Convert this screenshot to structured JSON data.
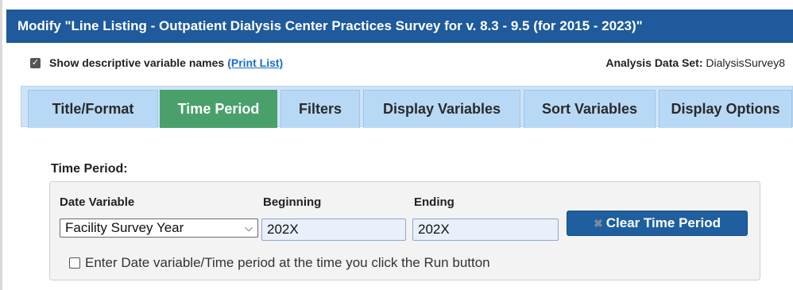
{
  "window": {
    "title": "Modify \"Line Listing - Outpatient Dialysis Center Practices Survey for v. 8.3 - 9.5 (for 2015 - 2023)\""
  },
  "options": {
    "show_descriptive_label": "Show descriptive variable names",
    "show_descriptive_checked": true,
    "print_list_link": "(Print List)",
    "analysis_data_set_label": "Analysis Data Set:",
    "analysis_data_set_value": "DialysisSurvey8"
  },
  "tabs": [
    {
      "label": "Title/Format",
      "active": false
    },
    {
      "label": "Time Period",
      "active": true
    },
    {
      "label": "Filters",
      "active": false
    },
    {
      "label": "Display Variables",
      "active": false
    },
    {
      "label": "Sort Variables",
      "active": false
    },
    {
      "label": "Display Options",
      "active": false
    }
  ],
  "time_period": {
    "section_title": "Time Period:",
    "date_variable_label": "Date Variable",
    "date_variable_value": "Facility Survey Year",
    "beginning_label": "Beginning",
    "beginning_value": "202X",
    "ending_label": "Ending",
    "ending_value": "202X",
    "clear_button_label": "Clear Time Period",
    "prompt_checkbox_checked": false,
    "prompt_label": "Enter Date variable/Time period at the time you click the Run button"
  },
  "colors": {
    "title_bar": "#1e5a9c",
    "active_tab": "#4aa06a",
    "tab": "#b8d9f5",
    "button": "#1f5f9f",
    "link": "#1a6fc7"
  },
  "icons": {
    "dropdown": "chevron-down-icon",
    "clear": "close-icon",
    "checked": "check-icon"
  }
}
